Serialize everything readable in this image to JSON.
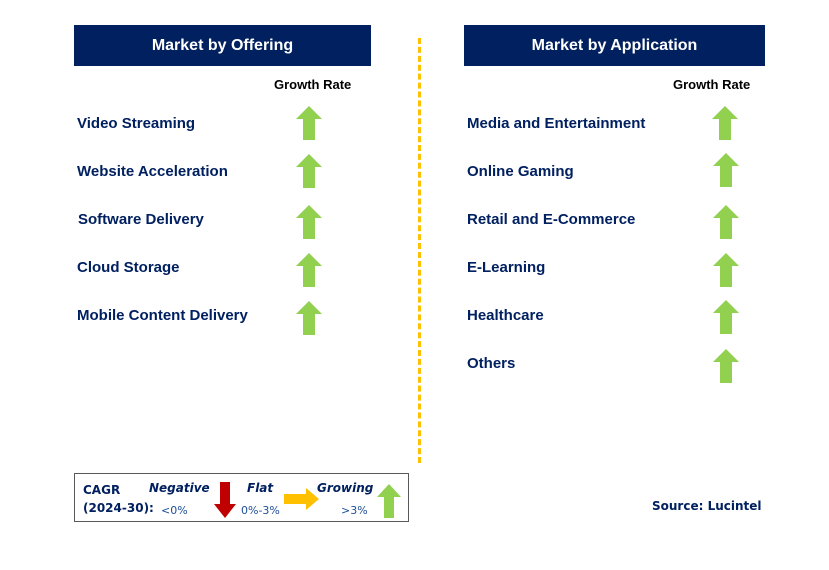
{
  "left_panel": {
    "title": "Market by Offering",
    "growth_header": "Growth Rate",
    "items": [
      {
        "label": "Video Streaming",
        "trend": "growing"
      },
      {
        "label": "Website Acceleration",
        "trend": "growing"
      },
      {
        "label": "Software Delivery",
        "trend": "growing"
      },
      {
        "label": "Cloud Storage",
        "trend": "growing"
      },
      {
        "label": "Mobile Content Delivery",
        "trend": "growing"
      }
    ]
  },
  "right_panel": {
    "title": "Market by Application",
    "growth_header": "Growth Rate",
    "items": [
      {
        "label": "Media and Entertainment",
        "trend": "growing"
      },
      {
        "label": "Online Gaming",
        "trend": "growing"
      },
      {
        "label": "Retail and E-Commerce",
        "trend": "growing"
      },
      {
        "label": "E-Learning",
        "trend": "growing"
      },
      {
        "label": "Healthcare",
        "trend": "growing"
      },
      {
        "label": "Others",
        "trend": "growing"
      }
    ]
  },
  "legend": {
    "cagr_label": "CAGR",
    "period_label": "(2024-30):",
    "negative": {
      "label": "Negative",
      "range": "<0%",
      "icon": "arrow-down-icon",
      "color": "#c00000"
    },
    "flat": {
      "label": "Flat",
      "range": "0%-3%",
      "icon": "arrow-right-icon",
      "color": "#ffc000"
    },
    "growing": {
      "label": "Growing",
      "range": ">3%",
      "icon": "arrow-up-icon",
      "color": "#92d050"
    }
  },
  "source": "Source: Lucintel",
  "colors": {
    "header_bg": "#002060",
    "text_primary": "#002060",
    "growth_arrow": "#92d050",
    "divider": "#ffc000"
  }
}
